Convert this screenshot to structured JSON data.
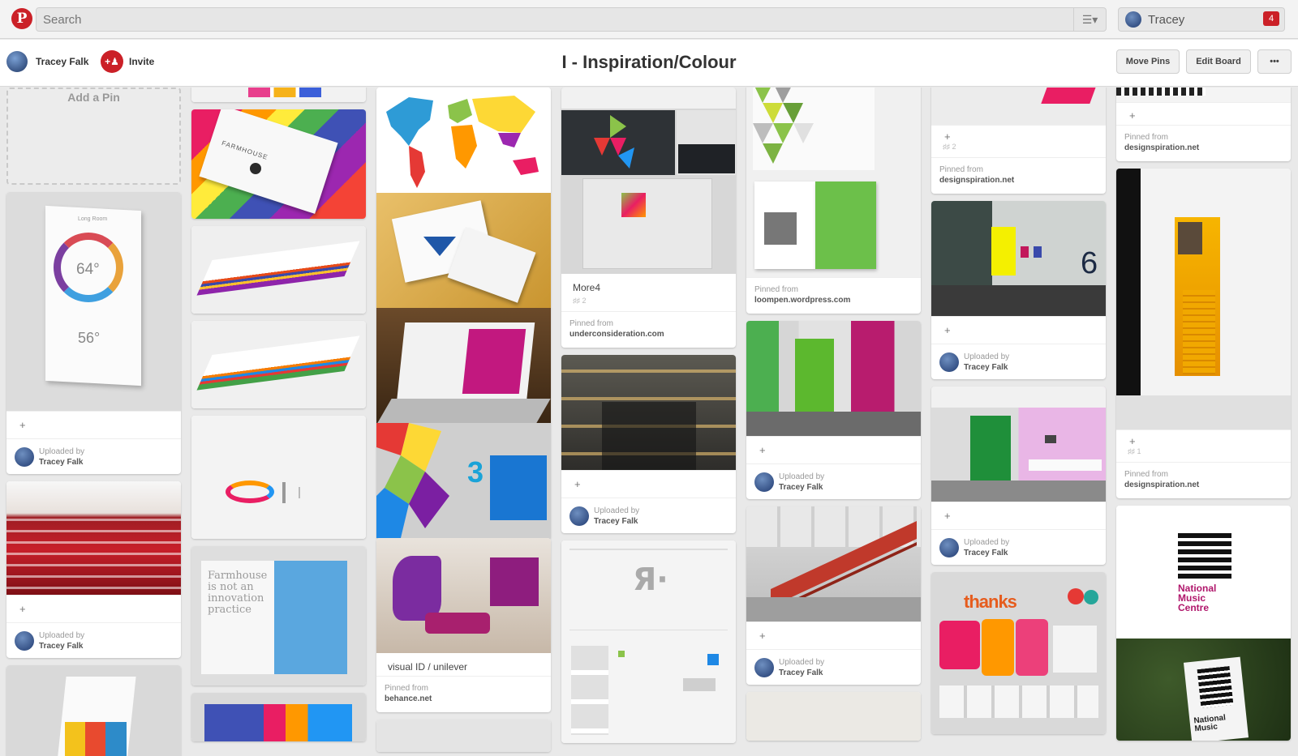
{
  "topbar": {
    "search_placeholder": "Search",
    "user_name": "Tracey",
    "notification_count": "4"
  },
  "board": {
    "owner_name": "Tracey Falk",
    "invite_label": "Invite",
    "title": "I - Inspiration/Colour",
    "move_pins_label": "Move Pins",
    "edit_board_label": "Edit Board",
    "more_label": "•••"
  },
  "add_pin_label": "Add a Pin",
  "pins": {
    "c1_thermo": {
      "uploaded_by": "Uploaded by",
      "user": "Tracey Falk",
      "temp_high": "64°",
      "temp_low": "56°",
      "card_label": "Long Room"
    },
    "c1_stairs": {
      "uploaded_by": "Uploaded by",
      "user": "Tracey Falk"
    },
    "c2_cards": {
      "brand": "FARMHOUSE"
    },
    "c2_book": {
      "text": "Farmhouse is not an innovation practice"
    },
    "c3_unilever": {
      "description": "visual ID / unilever",
      "pinned_from": "Pinned from",
      "source": "behance.net",
      "mural_number": "3"
    },
    "c4_more4": {
      "description": "More4",
      "stats": "♯♯ 2",
      "pinned_from": "Pinned from",
      "source": "underconsideration.com"
    },
    "c4_library": {
      "uploaded_by": "Uploaded by",
      "user": "Tracey Falk"
    },
    "c5_green_book": {
      "pinned_from": "Pinned from",
      "source": "loompen.wordpress.com"
    },
    "c5_green_door": {
      "uploaded_by": "Uploaded by",
      "user": "Tracey Falk"
    },
    "c5_red_stairs": {
      "uploaded_by": "Uploaded by",
      "user": "Tracey Falk"
    },
    "c6_top": {
      "stats": "♯♯ 2",
      "pinned_from": "Pinned from",
      "source": "designspiration.net"
    },
    "c6_corridor": {
      "uploaded_by": "Uploaded by",
      "user": "Tracey Falk",
      "wall_number": "6"
    },
    "c6_office": {
      "uploaded_by": "Uploaded by",
      "user": "Tracey Falk"
    },
    "c6_thanks": {
      "word": "thanks"
    },
    "c7_top": {
      "pinned_from": "Pinned from",
      "source": "designspiration.net"
    },
    "c7_yellow": {
      "stats": "♯♯ 1",
      "pinned_from": "Pinned from",
      "source": "designspiration.net"
    },
    "c7_nmc": {
      "line1": "National",
      "line2": "Music",
      "line3": "Centre",
      "footer": "National Music"
    }
  },
  "add_symbol": "+",
  "colors": {
    "brand_red": "#cb2027"
  }
}
